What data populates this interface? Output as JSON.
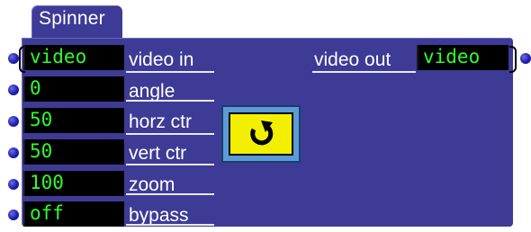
{
  "actor": {
    "title": "Spinner"
  },
  "inputs": [
    {
      "value": "video",
      "label": "video in"
    },
    {
      "value": "0",
      "label": "angle"
    },
    {
      "value": "50",
      "label": "horz ctr"
    },
    {
      "value": "50",
      "label": "vert ctr"
    },
    {
      "value": "100",
      "label": "zoom"
    },
    {
      "value": "off",
      "label": "bypass"
    }
  ],
  "outputs": [
    {
      "value": "video",
      "label": "video out"
    }
  ],
  "icons": {
    "button": "rotate-clockwise-icon",
    "ports": "port-dot-icon"
  },
  "colors": {
    "panel": "#3d3b95",
    "field_bg": "#000000",
    "field_text": "#2cff2c",
    "button_face": "#f2f000",
    "button_frame": "#5c9bd6",
    "port": "#1f1fb0"
  }
}
